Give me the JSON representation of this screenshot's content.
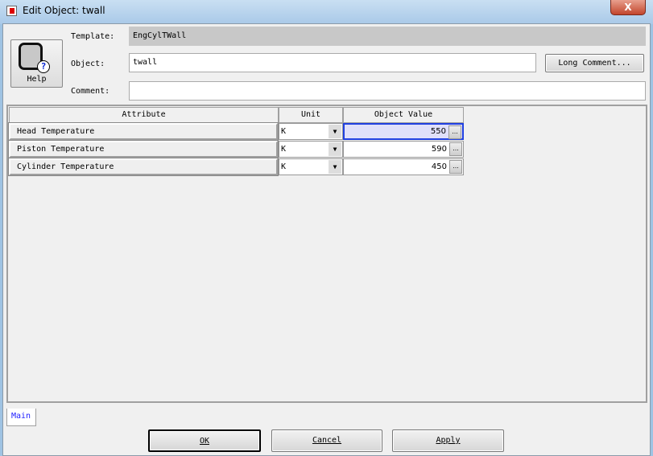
{
  "window": {
    "title": "Edit Object: twall",
    "close_label": "X"
  },
  "header": {
    "help_label": "Help",
    "template_label": "Template:",
    "template_value": "EngCylTWall",
    "object_label": "Object:",
    "object_value": "twall",
    "comment_label": "Comment:",
    "comment_value": "",
    "long_comment_label": "Long Comment..."
  },
  "grid": {
    "columns": [
      "Attribute",
      "Unit",
      "Object Value"
    ],
    "rows": [
      {
        "attribute": "Head Temperature",
        "unit": "K",
        "value": "550"
      },
      {
        "attribute": "Piston Temperature",
        "unit": "K",
        "value": "590"
      },
      {
        "attribute": "Cylinder Temperature",
        "unit": "K",
        "value": "450"
      }
    ]
  },
  "tabs": [
    "Main"
  ],
  "buttons": {
    "ok": "OK",
    "cancel": "Cancel",
    "apply": "Apply"
  }
}
